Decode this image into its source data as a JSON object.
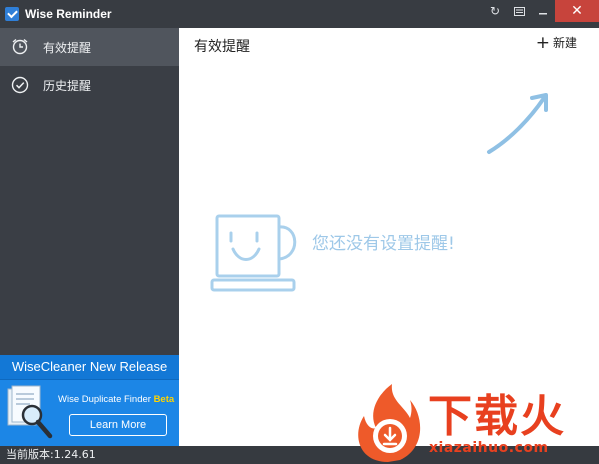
{
  "window": {
    "title": "Wise Reminder"
  },
  "sidebar": {
    "items": [
      {
        "label": "有效提醒",
        "icon": "alarm-clock-icon",
        "active": true
      },
      {
        "label": "历史提醒",
        "icon": "check-circle-icon",
        "active": false
      }
    ]
  },
  "promo": {
    "title": "WiseCleaner New Release",
    "product": "Wise Duplicate Finder",
    "badge": "Beta",
    "button": "Learn More"
  },
  "main": {
    "title": "有效提醒",
    "new_button": "新建",
    "empty_message": "您还没有设置提醒!"
  },
  "status": {
    "version": "当前版本:1.24.61"
  },
  "watermark": {
    "brand": "下载火",
    "url": "xiazaihuo.com"
  },
  "colors": {
    "sidebar_bg": "#3a3e45",
    "active_item_bg": "#50555d",
    "promo_bg": "#1c86e6",
    "accent_light": "#9ec8e8",
    "close_btn": "#c7443c",
    "watermark": "#e8401f"
  }
}
